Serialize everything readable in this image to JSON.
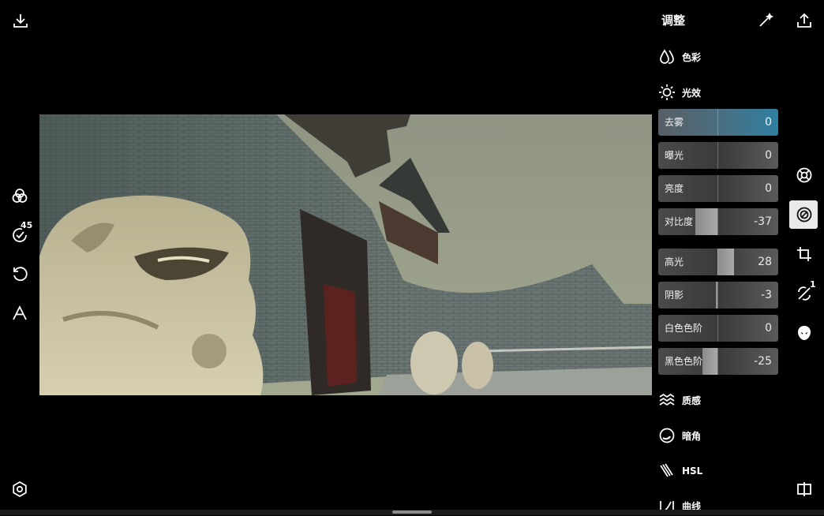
{
  "panel": {
    "title": "调整",
    "sections": [
      {
        "id": "color",
        "label": "色彩",
        "icon": "color-drops-icon"
      },
      {
        "id": "light",
        "label": "光效",
        "icon": "sun-icon"
      },
      {
        "id": "texture",
        "label": "质感",
        "icon": "waves-icon"
      },
      {
        "id": "vignette",
        "label": "暗角",
        "icon": "vignette-icon"
      },
      {
        "id": "hsl",
        "label": "HSL",
        "icon": "hsl-brush-icon"
      },
      {
        "id": "curves",
        "label": "曲线",
        "icon": "curves-icon"
      }
    ],
    "sliders": [
      {
        "label": "去雾",
        "value": "0",
        "level": 0,
        "active": true
      },
      {
        "label": "曝光",
        "value": "0",
        "level": 0,
        "active": false
      },
      {
        "label": "亮度",
        "value": "0",
        "level": 0,
        "active": false
      },
      {
        "label": "对比度",
        "value": "-37",
        "level": -37,
        "active": false
      },
      {
        "label": "高光",
        "value": "28",
        "level": 28,
        "active": false
      },
      {
        "label": "阴影",
        "value": "-3",
        "level": -3,
        "active": false
      },
      {
        "label": "白色色阶",
        "value": "0",
        "level": 0,
        "active": false
      },
      {
        "label": "黑色色阶",
        "value": "-25",
        "level": -25,
        "active": false
      }
    ]
  },
  "left_toolbar": {
    "presets_badge": "45"
  },
  "right_toolbar": {
    "healing_badge": "1"
  },
  "colors": {
    "accent_active": "#2f7fa1",
    "slider_bg": "#3a3a3a"
  }
}
